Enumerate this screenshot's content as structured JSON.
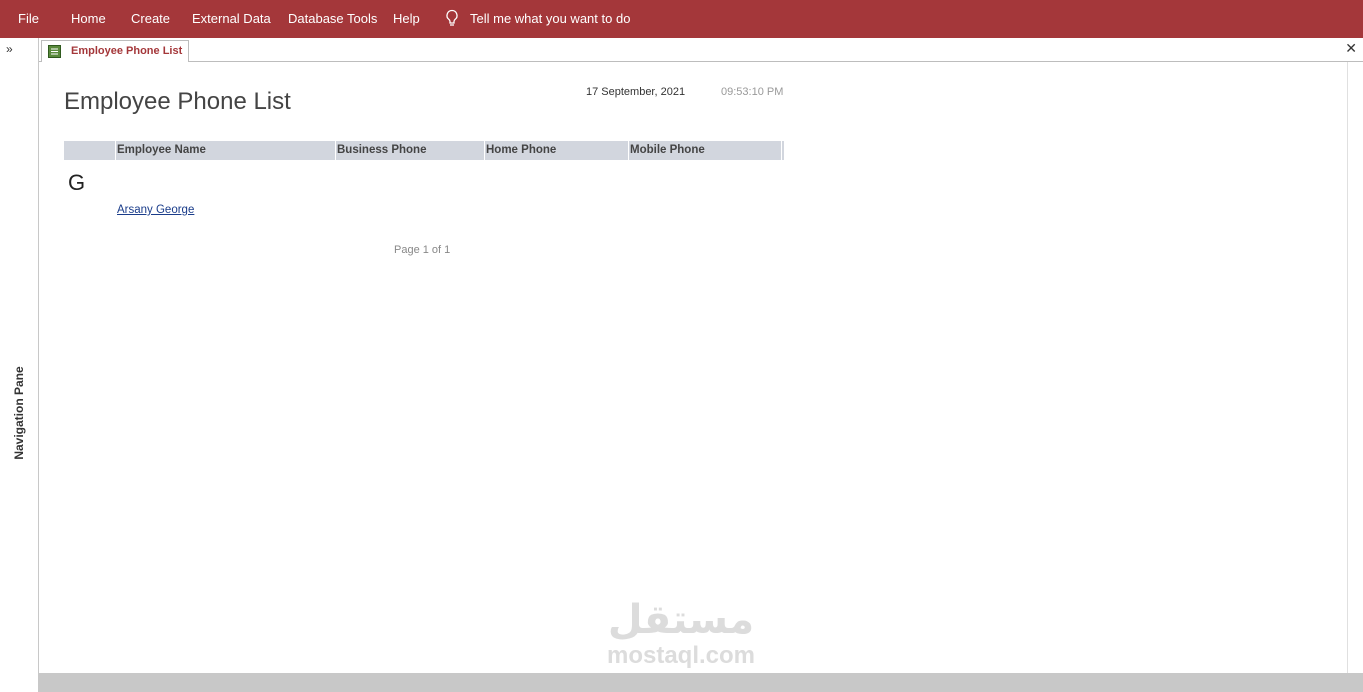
{
  "ribbon": {
    "tabs": [
      "File",
      "Home",
      "Create",
      "External Data",
      "Database Tools",
      "Help"
    ],
    "tell_me": "Tell me what you want to do"
  },
  "nav_pane": {
    "label": "Navigation Pane",
    "expand_glyph": "»"
  },
  "doc_tab": {
    "label": "Employee Phone List",
    "close_glyph": "✕"
  },
  "report": {
    "title": "Employee Phone List",
    "date": "17 September, 2021",
    "time": "09:53:10 PM",
    "columns": [
      "Employee Name",
      "Business Phone",
      "Home Phone",
      "Mobile Phone"
    ],
    "group_letter": "G",
    "rows": [
      {
        "name": "Arsany George"
      }
    ],
    "page_footer": "Page 1 of 1"
  },
  "watermark": {
    "arabic": "مستقل",
    "latin": "mostaql.com"
  },
  "colors": {
    "accent": "#a4373a",
    "header_bg": "#d2d6de",
    "link": "#1a3c8a"
  }
}
